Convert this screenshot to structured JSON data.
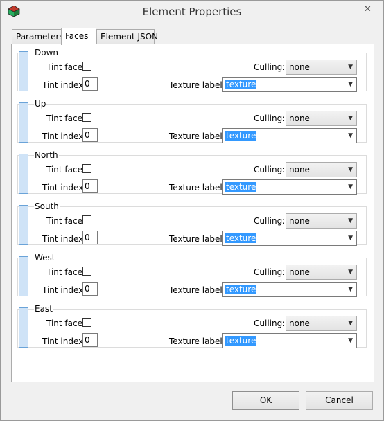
{
  "window": {
    "title": "Element Properties",
    "close_label": "✕"
  },
  "tabs": [
    {
      "label": "Parameters",
      "active": false
    },
    {
      "label": "Faces",
      "active": true
    },
    {
      "label": "Element JSON",
      "active": false
    }
  ],
  "faces": [
    {
      "name": "Down",
      "tint_face_label": "Tint face:",
      "tint_face_checked": false,
      "tint_index_label": "Tint index:",
      "tint_index": "0",
      "culling_label": "Culling:",
      "culling": "none",
      "texture_label": "Texture label:",
      "texture": "texture"
    },
    {
      "name": "Up",
      "tint_face_label": "Tint face:",
      "tint_face_checked": false,
      "tint_index_label": "Tint index:",
      "tint_index": "0",
      "culling_label": "Culling:",
      "culling": "none",
      "texture_label": "Texture label:",
      "texture": "texture"
    },
    {
      "name": "North",
      "tint_face_label": "Tint face:",
      "tint_face_checked": false,
      "tint_index_label": "Tint index:",
      "tint_index": "0",
      "culling_label": "Culling:",
      "culling": "none",
      "texture_label": "Texture label:",
      "texture": "texture"
    },
    {
      "name": "South",
      "tint_face_label": "Tint face:",
      "tint_face_checked": false,
      "tint_index_label": "Tint index:",
      "tint_index": "0",
      "culling_label": "Culling:",
      "culling": "none",
      "texture_label": "Texture label:",
      "texture": "texture"
    },
    {
      "name": "West",
      "tint_face_label": "Tint face:",
      "tint_face_checked": false,
      "tint_index_label": "Tint index:",
      "tint_index": "0",
      "culling_label": "Culling:",
      "culling": "none",
      "texture_label": "Texture label:",
      "texture": "texture"
    },
    {
      "name": "East",
      "tint_face_label": "Tint face:",
      "tint_face_checked": false,
      "tint_index_label": "Tint index:",
      "tint_index": "0",
      "culling_label": "Culling:",
      "culling": "none",
      "texture_label": "Texture label:",
      "texture": "texture"
    }
  ],
  "buttons": {
    "ok": "OK",
    "cancel": "Cancel"
  },
  "icons": {
    "app": "app-cube-icon",
    "dropdown": "chevron-down-icon"
  },
  "colors": {
    "face_bar": "#cfe3f7",
    "selection": "#3399ff"
  }
}
